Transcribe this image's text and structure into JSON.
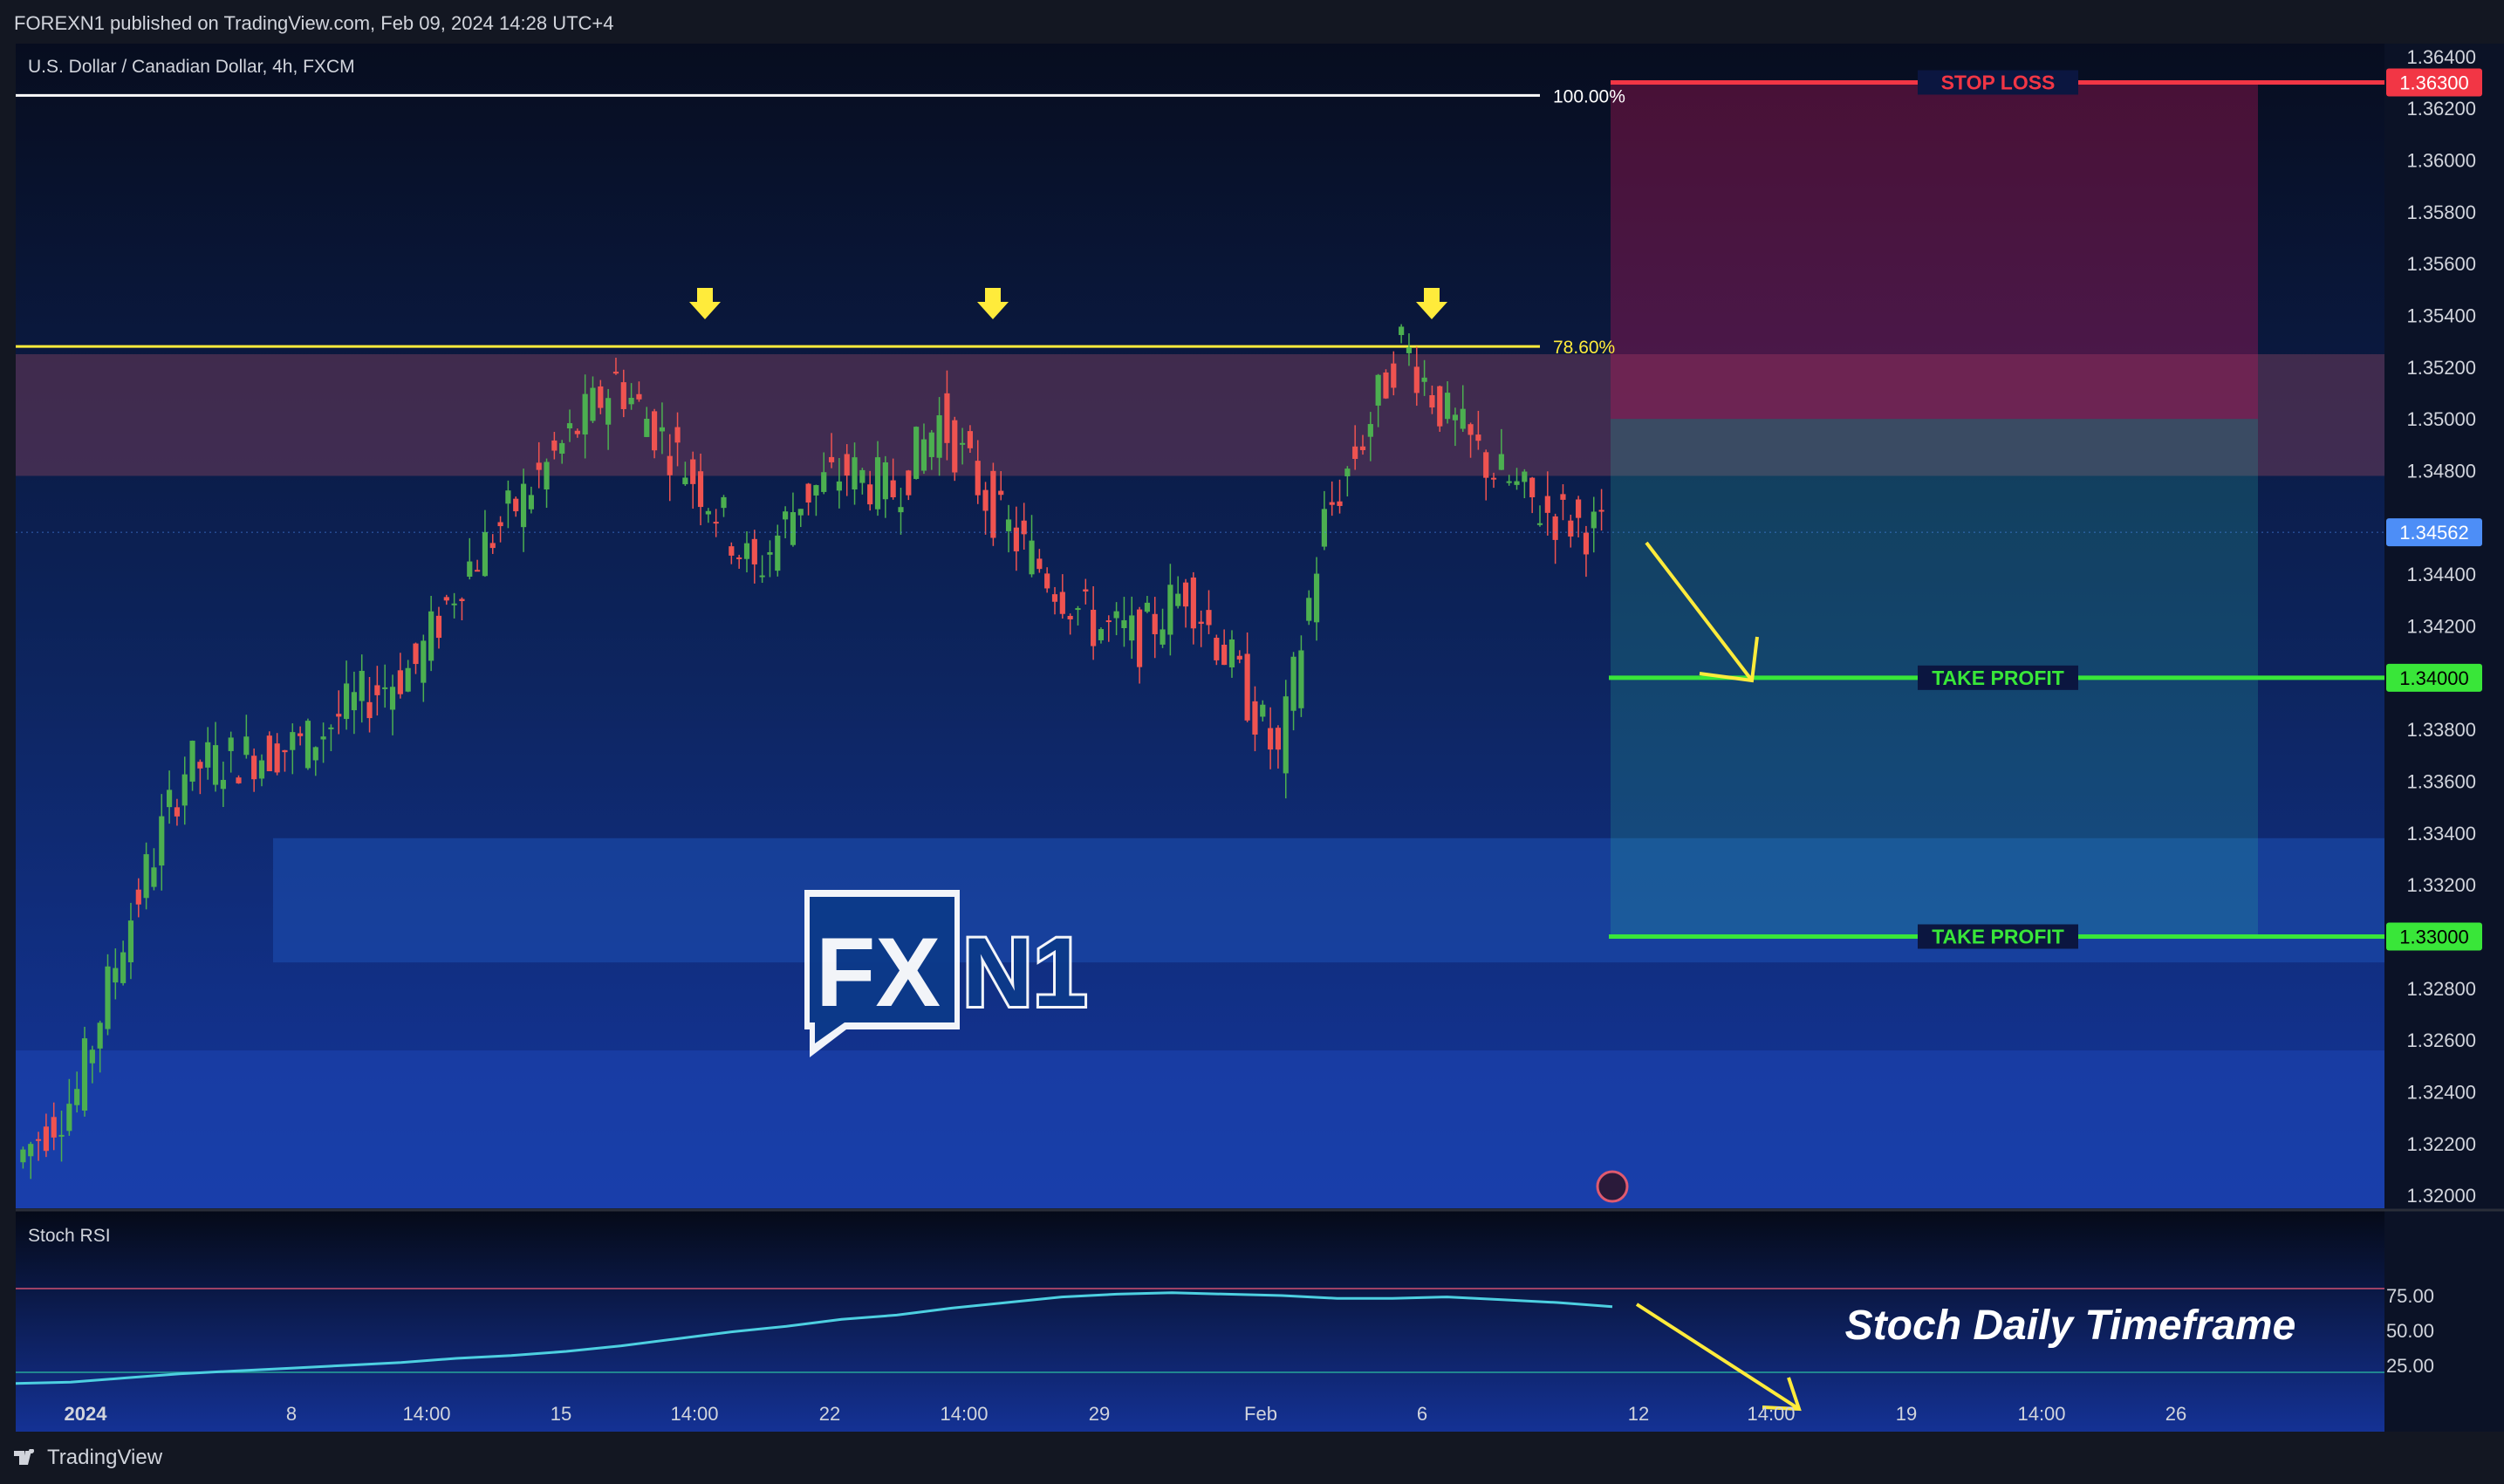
{
  "header": {
    "publish_line": "FOREXN1 published on TradingView.com, Feb 09, 2024 14:28 UTC+4"
  },
  "footer": {
    "brand": "TradingView"
  },
  "chart_data": [
    {
      "type": "candlestick",
      "title": "U.S. Dollar / Canadian Dollar, 4h, FXCM",
      "y_axis": {
        "ylim": [
          1.3195,
          1.3645
        ],
        "ticks": [
          "1.36400",
          "1.36200",
          "1.36000",
          "1.35800",
          "1.35600",
          "1.35400",
          "1.35200",
          "1.35000",
          "1.34800",
          "1.34400",
          "1.34200",
          "1.33800",
          "1.33600",
          "1.33400",
          "1.33200",
          "1.32800",
          "1.32600",
          "1.32400",
          "1.32200",
          "1.32000"
        ]
      },
      "x_axis": {
        "ticks": [
          "2024",
          "8",
          "14:00",
          "15",
          "14:00",
          "22",
          "14:00",
          "29",
          "Feb",
          "6",
          "12",
          "14:00",
          "19",
          "14:00",
          "26"
        ]
      },
      "current_price": "1.34562",
      "fib_levels": [
        {
          "label": "100.00%",
          "price": 1.3625,
          "color": "#ffffff"
        },
        {
          "label": "78.60%",
          "price": 1.3528,
          "color": "#ffeb3b"
        }
      ],
      "trade_levels": [
        {
          "label": "STOP LOSS",
          "price": 1.363,
          "price_label": "1.36300",
          "color": "#f23645"
        },
        {
          "label": "TAKE PROFIT",
          "price": 1.34,
          "price_label": "1.34000",
          "color": "#39e639"
        },
        {
          "label": "TAKE PROFIT",
          "price": 1.33,
          "price_label": "1.33000",
          "color": "#39e639"
        }
      ],
      "zones": [
        {
          "name": "resistance-zone",
          "from": 1.3478,
          "to": 1.3525,
          "color": "#6e3a5a"
        },
        {
          "name": "support-zone",
          "from": 1.329,
          "to": 1.3338,
          "color": "#1e50b4"
        },
        {
          "name": "lower-zone",
          "from": 1.3195,
          "to": 1.3256,
          "color": "#1e46b4"
        }
      ],
      "position": {
        "entry": 1.35,
        "stop": 1.363,
        "target": 1.33
      },
      "top_markers": 3,
      "watermark": "FXN1"
    },
    {
      "type": "line",
      "title": "Stoch RSI",
      "annotation": "Stoch Daily Timeframe",
      "y_ticks": [
        "75.00",
        "50.00",
        "25.00"
      ],
      "ylim": [
        0,
        100
      ],
      "bands": [
        80,
        20
      ],
      "x": [
        "2024",
        "8",
        "14:00",
        "15",
        "14:00",
        "22",
        "14:00",
        "29",
        "Feb",
        "6"
      ],
      "series": [
        {
          "color": "#4dd0e1",
          "values": [
            12,
            13,
            16,
            19,
            21,
            23,
            25,
            27,
            30,
            32,
            35,
            39,
            44,
            49,
            53,
            58,
            61,
            66,
            70,
            74,
            76,
            77,
            76,
            75,
            73,
            73,
            74,
            72,
            70,
            67
          ]
        }
      ]
    }
  ]
}
